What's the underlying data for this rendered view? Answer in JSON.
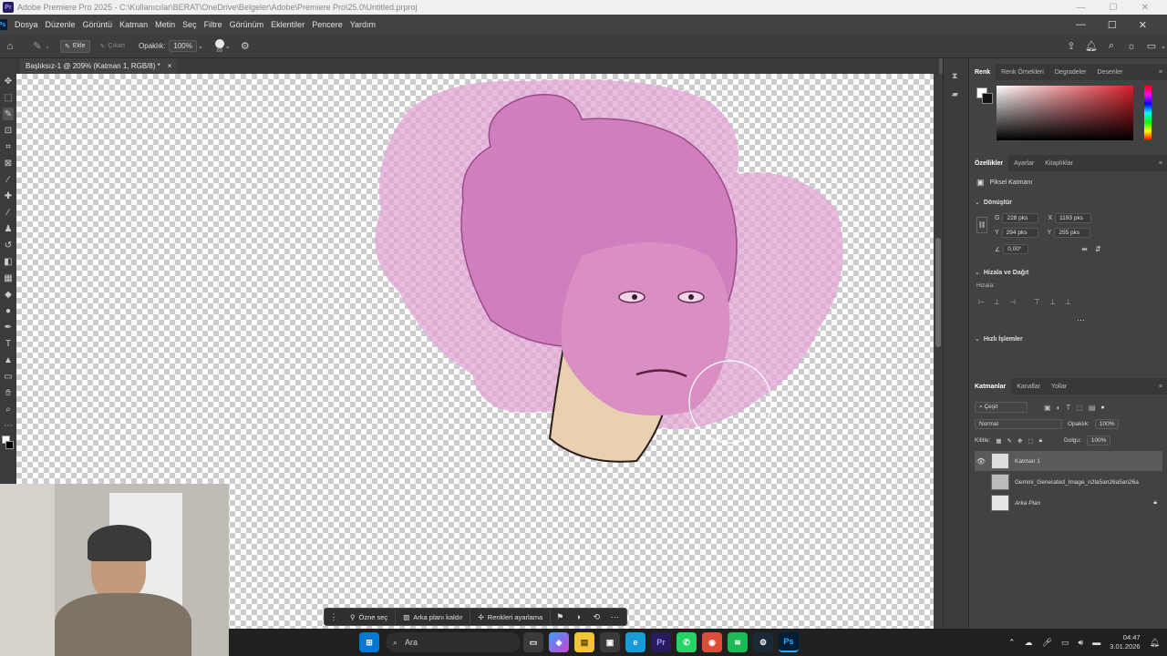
{
  "window": {
    "title": "Adobe Premiere Pro 2025 - C:\\Kullanıcılar\\BERAT\\OneDrive\\Belgeler\\Adobe\\Premiere Pro\\25.0\\Untitled.prproj",
    "app_icon": "Pr"
  },
  "menu": {
    "app_icon": "Ps",
    "items": [
      "Dosya",
      "Düzenle",
      "Görüntü",
      "Katman",
      "Metin",
      "Seç",
      "Filtre",
      "Görünüm",
      "Eklentiler",
      "Pencere",
      "Yardım"
    ]
  },
  "options": {
    "add_label": "Ekle",
    "subtract_label": "Çıkart",
    "opacity_label": "Opaklık:",
    "opacity_value": "100%",
    "brush_size": "68"
  },
  "document": {
    "tab_title": "Başlıksız-1 @ 209% (Katman 1, RGB/8) *",
    "close": "×"
  },
  "color_panel": {
    "tabs": [
      "Renk",
      "Renk Örnekleri",
      "Degradeler",
      "Desenler"
    ],
    "accent_color": "#d8202a"
  },
  "properties_panel": {
    "tabs": [
      "Özellikler",
      "Ayarlar",
      "Kitaplıklar"
    ],
    "layer_type": "Piksel Katmanı",
    "transform_title": "Dönüştür",
    "w_label": "G",
    "w_value": "228 pks",
    "x_label": "X",
    "x_value": "1193 pks",
    "h_label": "Y",
    "h_value": "294 pks",
    "y_label": "Y",
    "y_value": "255 pks",
    "angle_value": "0,00°",
    "align_title": "Hizala ve Dağıt",
    "align_label": "Hizala:",
    "quick_title": "Hızlı İşlemler"
  },
  "layers_panel": {
    "tabs": [
      "Katmanlar",
      "Kanallar",
      "Yollar"
    ],
    "filter_label": "Çeşit",
    "blend_mode": "Normal",
    "opacity_label": "Opaklık:",
    "opacity_value": "100%",
    "lock_label": "Kilitle:",
    "fill_label": "Dolgu:",
    "fill_value": "100%",
    "layers": [
      {
        "name": "Katman 1",
        "visible": true,
        "selected": true
      },
      {
        "name": "Gemini_Generated_Image_n2la5an26a5an26a",
        "visible": false,
        "selected": false
      },
      {
        "name": "Arka Plan",
        "visible": false,
        "selected": false,
        "locked": true
      }
    ]
  },
  "context_bar": {
    "select_subject": "Özne seç",
    "remove_bg": "Arka planı kaldır",
    "adjust_colors": "Renkleri ayarlama"
  },
  "taskbar": {
    "search_placeholder": "Ara",
    "time": "04:47",
    "date": "3.01.2026",
    "apps": [
      "windows",
      "search",
      "task-view",
      "copilot",
      "file-explorer",
      "store",
      "edge",
      "premiere",
      "whatsapp",
      "chrome",
      "spotify",
      "steam",
      "photoshop"
    ]
  }
}
